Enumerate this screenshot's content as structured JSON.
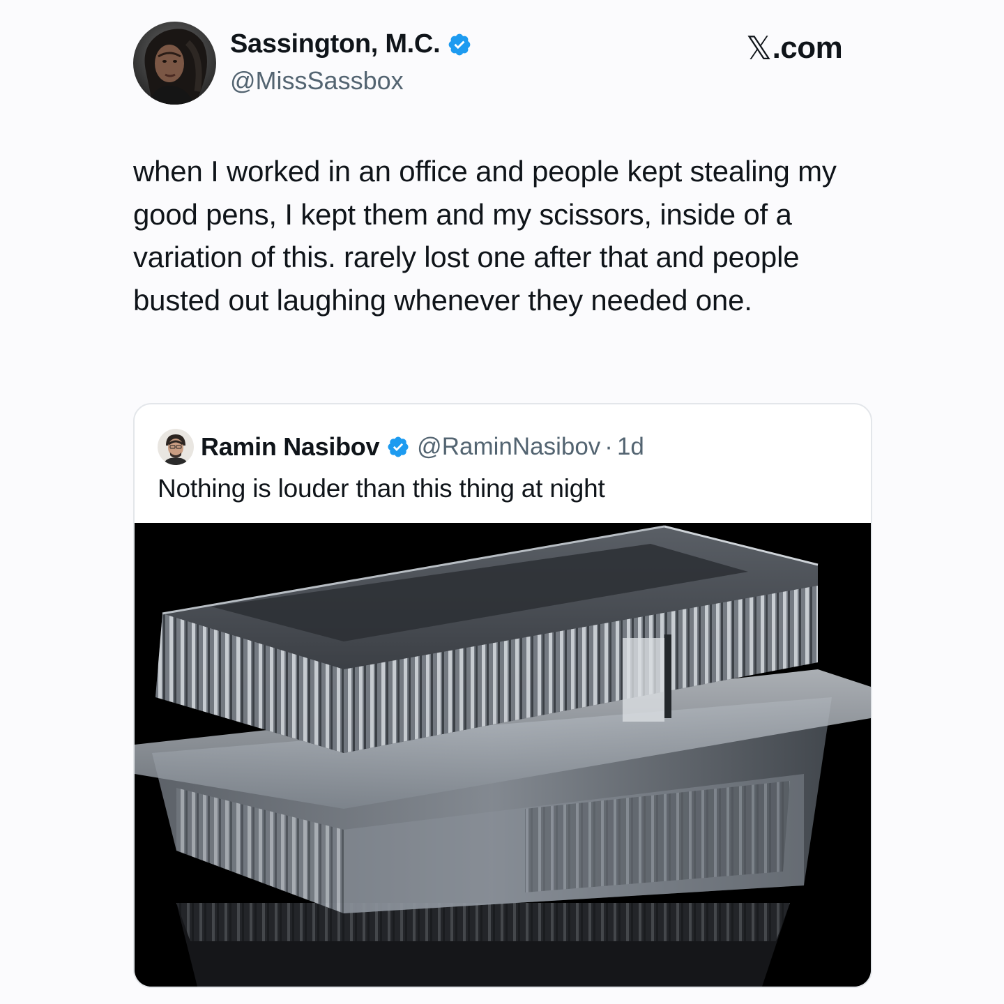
{
  "tweet": {
    "author": {
      "display_name": "Sassington, M.C.",
      "handle": "@MissSassbox",
      "verified": true,
      "avatar_icon": "profile-photo"
    },
    "brand": {
      "x_glyph": "𝕏",
      "suffix": ".com"
    },
    "text": "when I worked in an office and people kept stealing my good pens, I kept them and my scissors, inside of a variation of this. rarely lost one after that and people busted out laughing whenever they needed one."
  },
  "quote": {
    "author": {
      "display_name": "Ramin Nasibov",
      "handle": "@RaminNasibov",
      "verified": true,
      "avatar_icon": "profile-photo"
    },
    "separator": "·",
    "time": "1d",
    "text": "Nothing is louder than this thing at night",
    "media": {
      "description_icon": "clear-plastic-clamshell-container-photo"
    }
  },
  "colors": {
    "background": "#fbfbfd",
    "text_primary": "#0f1419",
    "text_secondary": "#536471",
    "verified_blue": "#1d9bf0",
    "card_border": "#e3e6ea",
    "media_bg": "#000000"
  }
}
